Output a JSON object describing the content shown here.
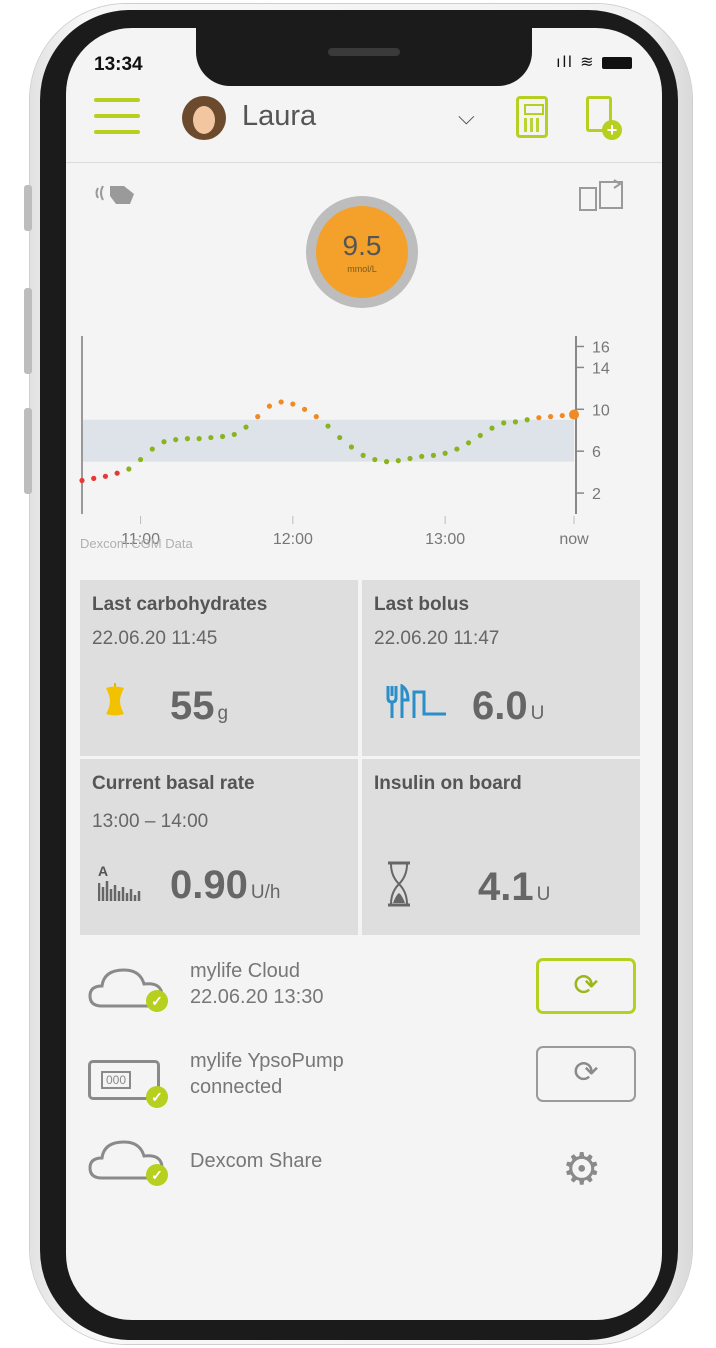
{
  "status_bar": {
    "time": "13:34",
    "signal": "ıll"
  },
  "header": {
    "user_name": "Laura",
    "dropdown_icon": "chevron-down-icon",
    "menu_icon": "hamburger-icon",
    "calculator_icon": "bolus-calculator-icon",
    "logbook_icon": "add-log-entry-icon"
  },
  "glucose": {
    "value": "9.5",
    "unit": "mmol/L",
    "ring_color": "#f3a12a"
  },
  "chart_data": {
    "type": "scatter",
    "x_ticks": [
      "11:00",
      "12:00",
      "13:00",
      "now"
    ],
    "y_ticks": [
      2,
      6,
      10,
      14,
      16
    ],
    "ylim": [
      0,
      17
    ],
    "target_range": [
      5,
      9
    ],
    "source": "Dexcom CGM Data",
    "colors": {
      "low": "#e53935",
      "in_range": "#8bb31f",
      "high": "#f08a24",
      "current": "#f08a24"
    },
    "series": [
      {
        "values": [
          [
            0.0,
            3.2
          ],
          [
            0.3,
            3.4
          ],
          [
            0.6,
            3.6
          ],
          [
            0.9,
            3.9
          ],
          [
            1.2,
            4.3
          ],
          [
            1.5,
            5.2
          ],
          [
            1.8,
            6.2
          ],
          [
            2.1,
            6.9
          ],
          [
            2.4,
            7.1
          ],
          [
            2.7,
            7.2
          ],
          [
            3.0,
            7.2
          ],
          [
            3.3,
            7.3
          ],
          [
            3.6,
            7.4
          ],
          [
            3.9,
            7.6
          ],
          [
            4.2,
            8.3
          ],
          [
            4.5,
            9.3
          ],
          [
            4.8,
            10.3
          ],
          [
            5.1,
            10.7
          ],
          [
            5.4,
            10.5
          ],
          [
            5.7,
            10.0
          ],
          [
            6.0,
            9.3
          ],
          [
            6.3,
            8.4
          ],
          [
            6.6,
            7.3
          ],
          [
            6.9,
            6.4
          ],
          [
            7.2,
            5.6
          ],
          [
            7.5,
            5.2
          ],
          [
            7.8,
            5.0
          ],
          [
            8.1,
            5.1
          ],
          [
            8.4,
            5.3
          ],
          [
            8.7,
            5.5
          ],
          [
            9.0,
            5.6
          ],
          [
            9.3,
            5.8
          ],
          [
            9.6,
            6.2
          ],
          [
            9.9,
            6.8
          ],
          [
            10.2,
            7.5
          ],
          [
            10.5,
            8.2
          ],
          [
            10.8,
            8.7
          ],
          [
            11.1,
            8.8
          ],
          [
            11.4,
            9.0
          ],
          [
            11.7,
            9.2
          ],
          [
            12.0,
            9.3
          ],
          [
            12.3,
            9.4
          ],
          [
            12.6,
            9.5
          ]
        ]
      }
    ]
  },
  "tiles": {
    "carbs": {
      "title": "Last carbohydrates",
      "datetime": "22.06.20  11:45",
      "value": "55",
      "unit": "g",
      "icon": "apple-core-icon"
    },
    "bolus": {
      "title": "Last bolus",
      "datetime": "22.06.20  11:47",
      "value": "6.0",
      "unit": "U",
      "icon": "meal-bolus-icon"
    },
    "basal": {
      "title": "Current basal rate",
      "period": "13:00 – 14:00",
      "value": "0.90",
      "unit": "U/h",
      "icon": "basal-rate-icon",
      "icon_label": "A"
    },
    "iob": {
      "title": "Insulin on board",
      "value": "4.1",
      "unit": "U",
      "icon": "hourglass-icon"
    }
  },
  "connections": [
    {
      "name": "mylife Cloud",
      "detail": "22.06.20  13:30",
      "icon": "cloud-icon",
      "action_icon": "sync-icon",
      "pump_display": ""
    },
    {
      "name": "mylife YpsoPump",
      "detail": "connected",
      "icon": "pump-icon",
      "action_icon": "sync-icon",
      "pump_display": "000"
    },
    {
      "name": "Dexcom Share",
      "detail": "",
      "icon": "cloud-icon",
      "action_icon": "gear-icon",
      "pump_display": ""
    }
  ],
  "colors": {
    "accent": "#b7cf1f",
    "tile_bg": "#dedede"
  }
}
